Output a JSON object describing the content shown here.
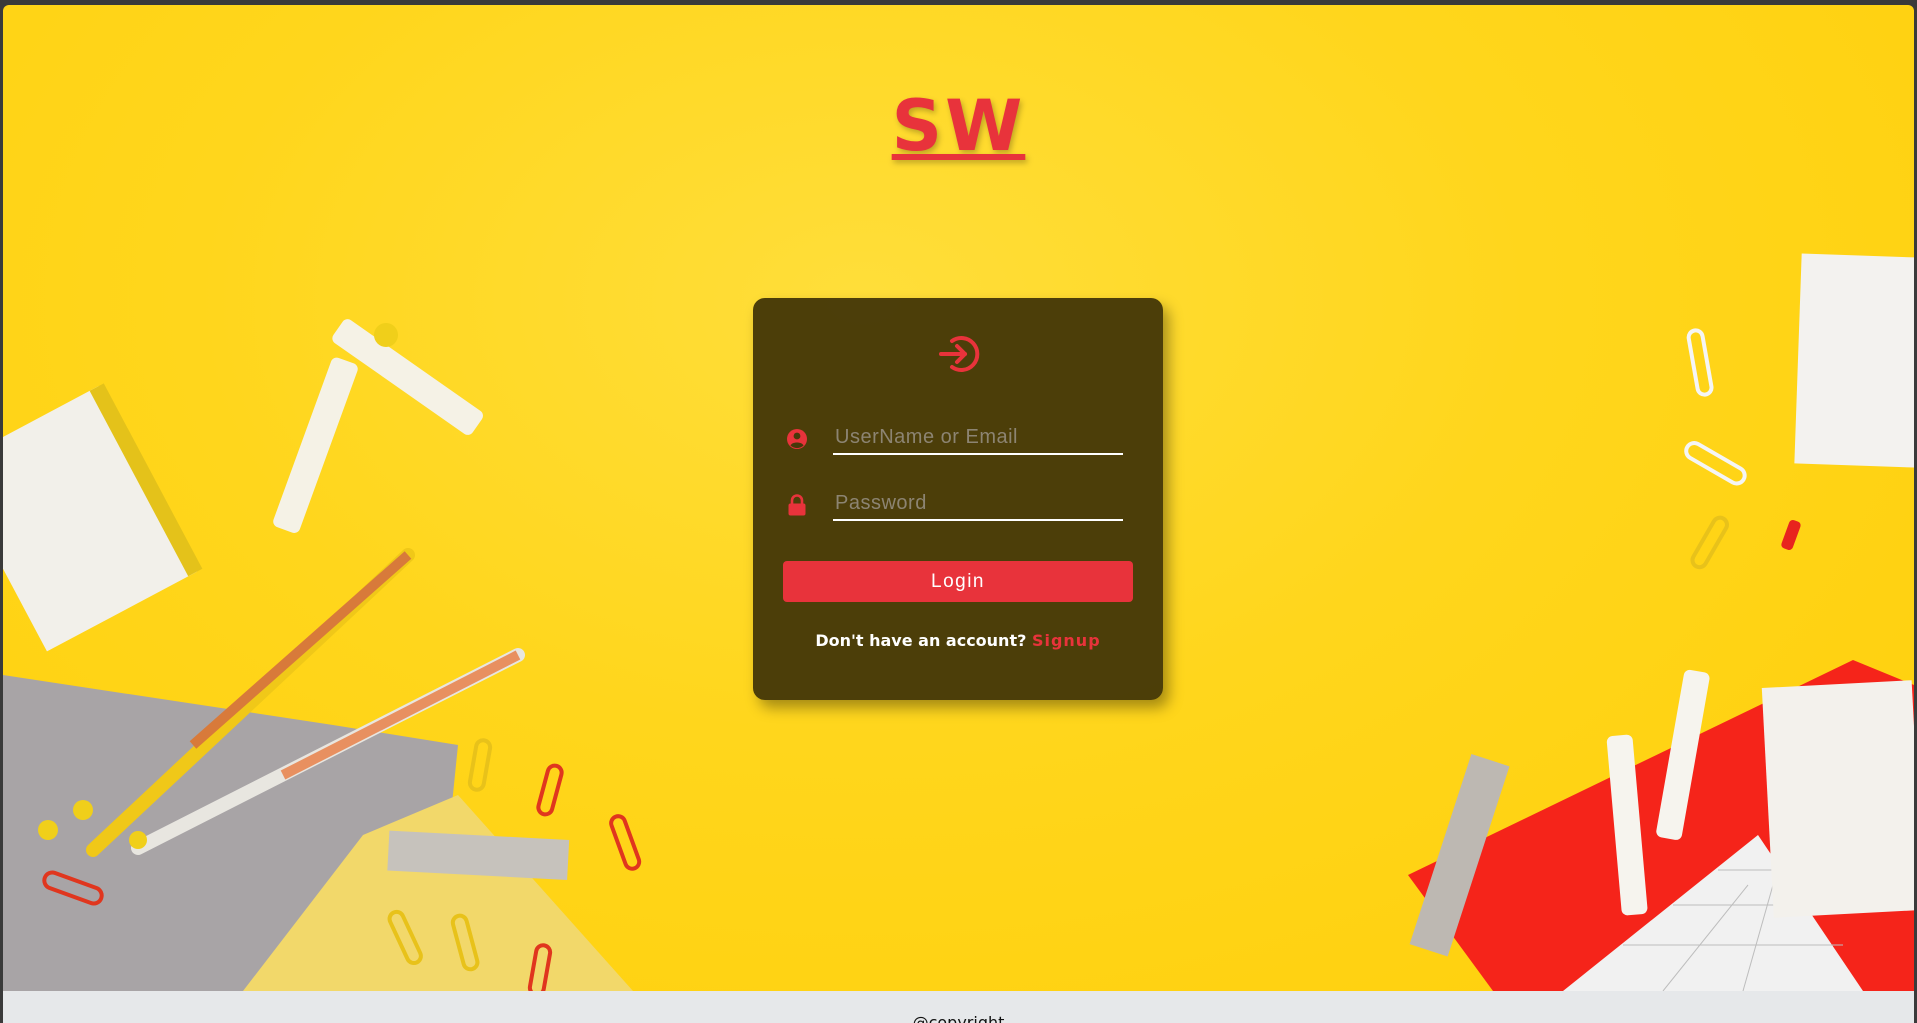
{
  "app": {
    "logo_text": "SW"
  },
  "login_form": {
    "icon": "sign-in-icon",
    "username": {
      "icon": "user-circle-icon",
      "placeholder": "UserName or Email",
      "value": ""
    },
    "password": {
      "icon": "lock-icon",
      "placeholder": "Password",
      "value": ""
    },
    "login_label": "Login",
    "signup_prompt": "Don't have an account?",
    "signup_label": "Signup"
  },
  "footer": {
    "text": "@copyright"
  },
  "colors": {
    "accent": "#e8333b",
    "card_bg": "#46390a",
    "background": "#ffd61c",
    "footer_bg": "#e6e8ea"
  }
}
